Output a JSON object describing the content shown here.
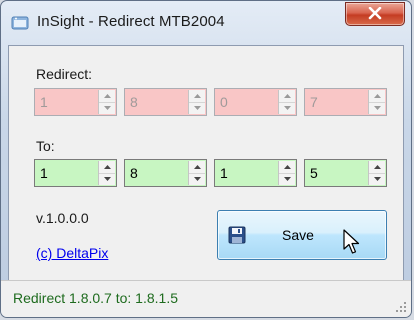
{
  "window": {
    "title": "InSight - Redirect MTB2004"
  },
  "redirect": {
    "label": "Redirect:",
    "fields": [
      "1",
      "8",
      "0",
      "7"
    ]
  },
  "to": {
    "label": "To:",
    "fields": [
      "1",
      "8",
      "1",
      "5"
    ]
  },
  "version": "v.1.0.0.0",
  "link": "(c) DeltaPix",
  "save_label": "Save",
  "status": "Redirect 1.8.0.7 to: 1.8.1.5",
  "colors": {
    "disabled_field": "#f9c6c6",
    "enabled_field": "#c8f6c2",
    "status_text": "#1e6b1e",
    "link": "#0000ee"
  },
  "icons": {
    "app": "app-window-icon",
    "close": "close-x-icon",
    "save": "floppy-disk-icon",
    "cursor": "mouse-pointer-icon",
    "grip": "resize-grip-icon"
  }
}
